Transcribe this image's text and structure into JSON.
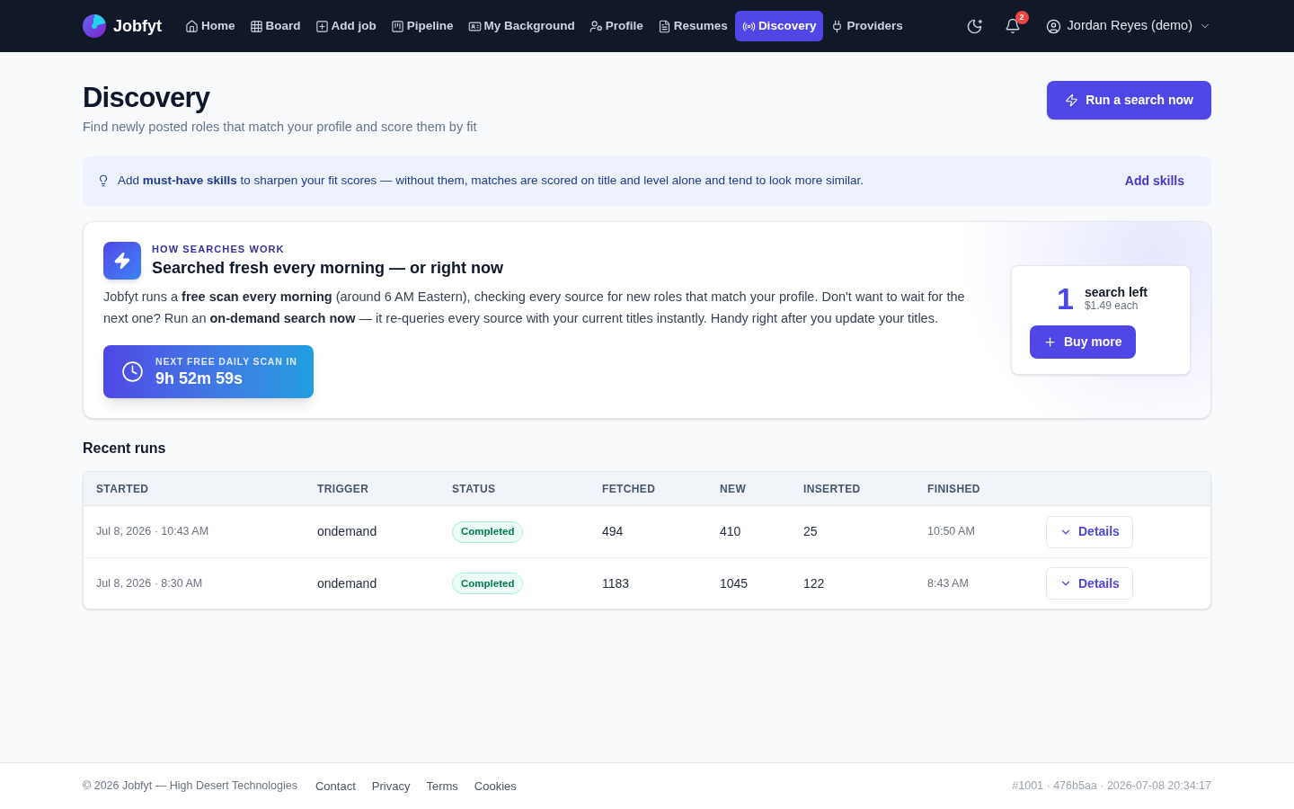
{
  "nav": {
    "brand": "Jobfyt",
    "items": [
      {
        "label": "Home",
        "selected": false
      },
      {
        "label": "Board",
        "selected": false
      },
      {
        "label": "Add job",
        "selected": false
      },
      {
        "label": "Pipeline",
        "selected": false
      },
      {
        "label": "My Background",
        "selected": false
      },
      {
        "label": "Profile",
        "selected": false
      },
      {
        "label": "Resumes",
        "selected": false
      },
      {
        "label": "Discovery",
        "selected": true
      },
      {
        "label": "Providers",
        "selected": false
      }
    ],
    "notifications": "2",
    "user": "Jordan Reyes (demo)"
  },
  "header": {
    "title": "Discovery",
    "subtitle": "Find newly posted roles that match your profile and score them by fit",
    "action": "Run a search now"
  },
  "tip": {
    "text": "Add **must-have skills** to sharpen your fit scores — without them, matches are scored on title and level alone and tend to look more similar.",
    "action": "Add skills"
  },
  "how_it_works": {
    "eyebrow": "HOW SEARCHES WORK",
    "title": "Searched fresh every morning — or right now",
    "body": "Jobfyt runs a **free scan every morning** (around 6 AM Eastern), checking every source for new roles that match your profile. Don't want to wait for the next one? Run an **on-demand search now** — it re-queries every source with your current titles instantly. Handy right after you update your titles.",
    "countdown": {
      "label": "NEXT FREE DAILY SCAN IN",
      "value": "9h 52m 59s"
    },
    "credits": {
      "count": "1",
      "label": "search left",
      "price": "$1.49 each",
      "action": "Buy more"
    }
  },
  "recent_runs": {
    "title": "Recent runs",
    "columns": [
      "STARTED",
      "TRIGGER",
      "STATUS",
      "FETCHED",
      "NEW",
      "INSERTED",
      "FINISHED"
    ],
    "rows": [
      {
        "started": "Jul 8, 2026 · 10:43 AM",
        "trigger": "ondemand",
        "status": "Completed",
        "fetched": "494",
        "new": "410",
        "inserted": "25",
        "finished": "10:50 AM",
        "action": "Details"
      },
      {
        "started": "Jul 8, 2026 · 8:30 AM",
        "trigger": "ondemand",
        "status": "Completed",
        "fetched": "1183",
        "new": "1045",
        "inserted": "122",
        "finished": "8:43 AM",
        "action": "Details"
      }
    ]
  },
  "footer": {
    "copyright": "© 2026 Jobfyt — High Desert Technologies",
    "links": [
      "Contact",
      "Privacy",
      "Terms",
      "Cookies"
    ],
    "build": "#1001 · 476b5aa · 2026-07-08 20:34:17"
  }
}
